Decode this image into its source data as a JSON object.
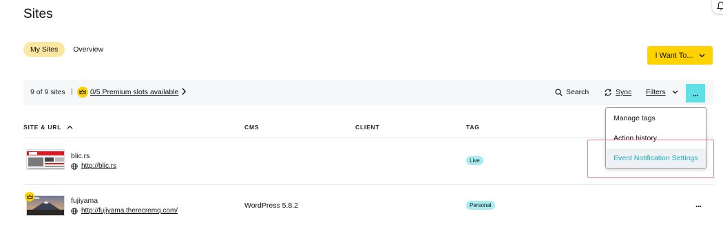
{
  "page": {
    "title": "Sites"
  },
  "tabs": [
    {
      "label": "My Sites",
      "active": true
    },
    {
      "label": "Overview",
      "active": false
    }
  ],
  "actions": {
    "want_label": "I Want To..."
  },
  "toolbar": {
    "count": "9 of 9 sites",
    "separator": "|",
    "premium_label": "0/5 Premium slots available",
    "search_label": "Search",
    "sync_label": "Sync",
    "filters_label": "Filters",
    "more_label": "..."
  },
  "columns": [
    {
      "label": "SITE & URL",
      "sorted": "ascending"
    },
    {
      "label": "CMS"
    },
    {
      "label": "CLIENT"
    },
    {
      "label": "TAG"
    }
  ],
  "sites": [
    {
      "name": "blic.rs",
      "url": "http://blic.rs",
      "cms": "",
      "client": "",
      "tag": "Live",
      "premium": false
    },
    {
      "name": "fujiyama",
      "url": "http://fujiyama.therecremq.com/",
      "cms": "WordPress 5.8.2",
      "client": "",
      "tag": "Personal",
      "premium": true
    }
  ],
  "row_actions": {
    "more_label": "..."
  },
  "dropdown": {
    "items": [
      {
        "label": "Manage tags"
      },
      {
        "label": "Action history"
      },
      {
        "label": "Event Notification Settings",
        "highlighted": true
      }
    ]
  },
  "colors": {
    "accent_yellow": "#ffd200",
    "active_tab": "#fbe6a2",
    "more_button": "#5ee0e6",
    "tag_bg": "#a8ecf0",
    "link_highlight": "#1fa9b8",
    "annotation_box": "#f0808a"
  },
  "icons": [
    "bell-icon",
    "crown-icon",
    "chevron-right-icon",
    "search-icon",
    "sync-icon",
    "chevron-down-icon",
    "globe-icon",
    "sort-up-icon"
  ]
}
